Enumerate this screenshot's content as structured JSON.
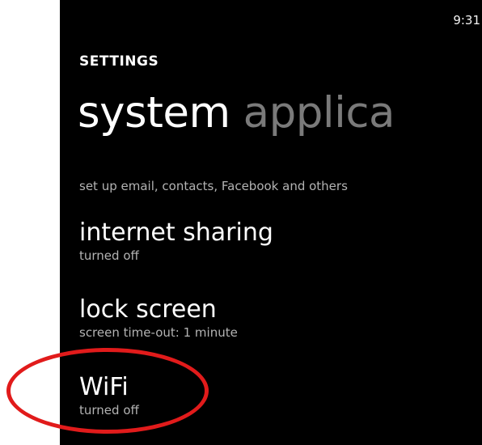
{
  "status_bar": {
    "time": "9:31"
  },
  "header": {
    "app_title": "SETTINGS",
    "pivot": {
      "active": "system",
      "next": "applica"
    }
  },
  "subtitle": "set up email, contacts, Facebook and others",
  "settings": [
    {
      "name": "internet sharing",
      "status": "turned off"
    },
    {
      "name": "lock screen",
      "status": "screen time-out: 1 minute"
    },
    {
      "name": "WiFi",
      "status": "turned off"
    }
  ],
  "annotation": {
    "color": "#e11b1b",
    "shape": "oval"
  },
  "colors": {
    "screen_background": "#000000",
    "primary_text": "#ffffff",
    "secondary_text": "#b3b3b3",
    "inactive_pivot": "#7a7a7a"
  }
}
